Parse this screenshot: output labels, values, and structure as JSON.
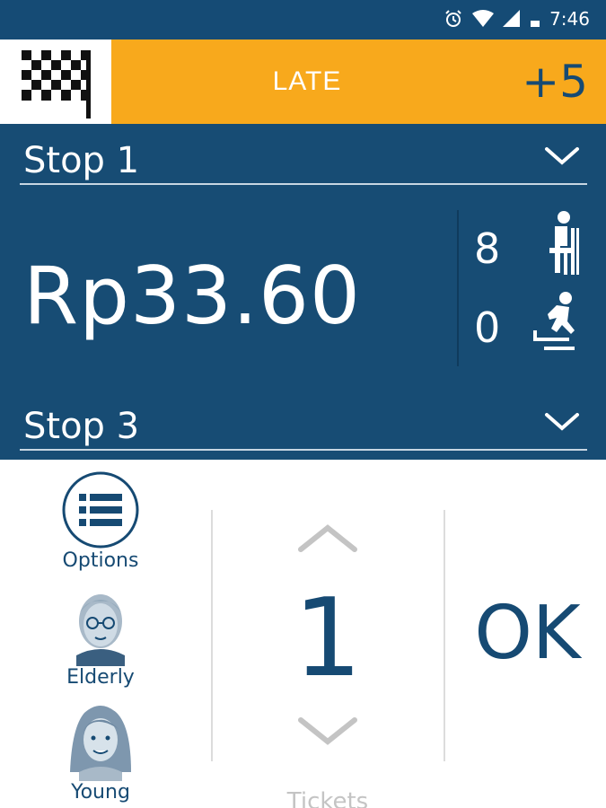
{
  "status_bar": {
    "time": "7:46",
    "icons": [
      "alarm-icon",
      "wifi-icon",
      "signal-icon",
      "battery-icon"
    ]
  },
  "header": {
    "status_label": "LATE",
    "delta": "+5",
    "icon": "checkered-flag-icon"
  },
  "route": {
    "current_stop": "Stop 1",
    "next_stop": "Stop 3",
    "fare": "Rp33.60",
    "seated": "8",
    "boarding": "0"
  },
  "passenger_types": [
    {
      "label": "Options",
      "icon": "list-icon"
    },
    {
      "label": "Elderly",
      "icon": "elderly-avatar-icon"
    },
    {
      "label": "Young",
      "icon": "young-avatar-icon"
    }
  ],
  "tickets": {
    "count": "1",
    "label": "Tickets"
  },
  "actions": {
    "ok_label": "OK"
  },
  "colors": {
    "primary": "#174c74",
    "accent": "#f8a91c",
    "text_on_primary": "#ffffff"
  }
}
